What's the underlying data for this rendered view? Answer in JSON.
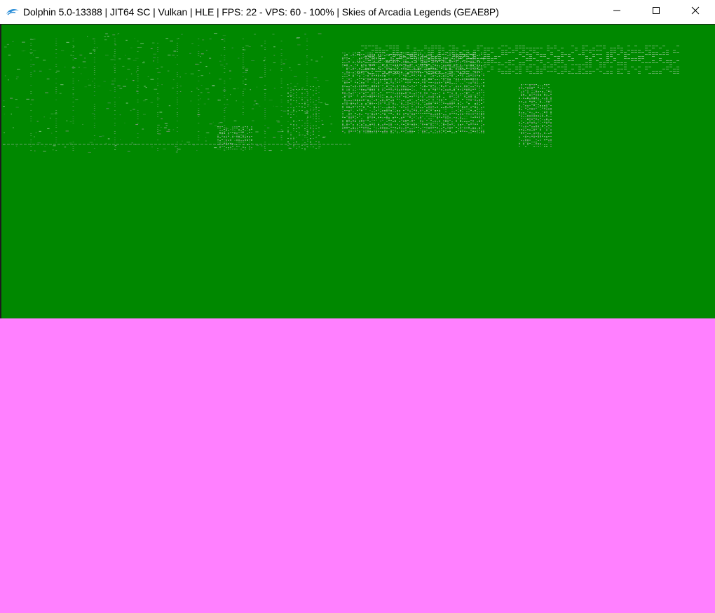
{
  "window": {
    "title": "Dolphin 5.0-13388 | JIT64 SC | Vulkan | HLE | FPS: 22 - VPS: 60 - 100% | Skies of Arcadia Legends (GEAE8P)",
    "icon": "dolphin-logo-icon",
    "controls": {
      "minimize_icon": "minimize-icon",
      "maximize_icon": "maximize-icon",
      "close_icon": "close-icon"
    }
  },
  "render_output": {
    "upper_color": "#008800",
    "lower_color": "#ff80ff",
    "artifact_colors": [
      "#c8d8c8",
      "#e0c8e8",
      "#9c9cb8",
      "#5aa05a",
      "#d8a0d0",
      "#ffffff"
    ]
  }
}
